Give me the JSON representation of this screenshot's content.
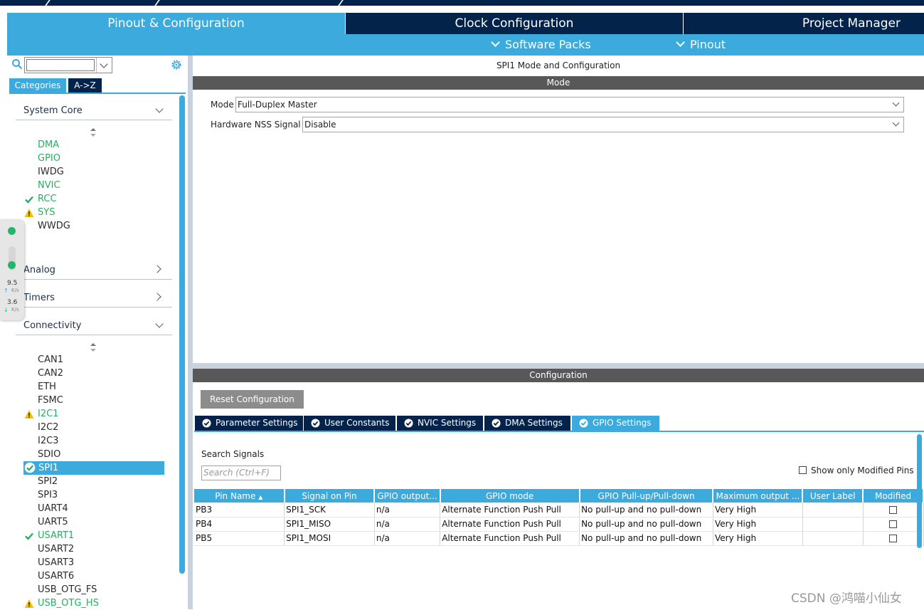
{
  "main_tabs": {
    "pinout": "Pinout & Configuration",
    "clock": "Clock Configuration",
    "project": "Project Manager"
  },
  "sub_menu": {
    "software_packs": "Software Packs",
    "pinout": "Pinout"
  },
  "left": {
    "search_value": "",
    "view_tabs": {
      "categories": "Categories",
      "az": "A->Z"
    },
    "system_core": {
      "header": "System Core",
      "items": [
        {
          "label": "DMA",
          "status": "configured"
        },
        {
          "label": "GPIO",
          "status": "configured"
        },
        {
          "label": "IWDG",
          "status": "none"
        },
        {
          "label": "NVIC",
          "status": "configured"
        },
        {
          "label": "RCC",
          "status": "ok"
        },
        {
          "label": "SYS",
          "status": "warning"
        },
        {
          "label": "WWDG",
          "status": "none"
        }
      ]
    },
    "analog": {
      "header": "Analog"
    },
    "timers": {
      "header": "Timers"
    },
    "connectivity": {
      "header": "Connectivity",
      "items": [
        {
          "label": "CAN1",
          "status": "none"
        },
        {
          "label": "CAN2",
          "status": "none"
        },
        {
          "label": "ETH",
          "status": "none"
        },
        {
          "label": "FSMC",
          "status": "none"
        },
        {
          "label": "I2C1",
          "status": "warning"
        },
        {
          "label": "I2C2",
          "status": "none"
        },
        {
          "label": "I2C3",
          "status": "none"
        },
        {
          "label": "SDIO",
          "status": "none"
        },
        {
          "label": "SPI1",
          "status": "selected"
        },
        {
          "label": "SPI2",
          "status": "none"
        },
        {
          "label": "SPI3",
          "status": "none"
        },
        {
          "label": "UART4",
          "status": "none"
        },
        {
          "label": "UART5",
          "status": "none"
        },
        {
          "label": "USART1",
          "status": "ok"
        },
        {
          "label": "USART2",
          "status": "none"
        },
        {
          "label": "USART3",
          "status": "none"
        },
        {
          "label": "USART6",
          "status": "none"
        },
        {
          "label": "USB_OTG_FS",
          "status": "none"
        },
        {
          "label": "USB_OTG_HS",
          "status": "warning"
        }
      ]
    }
  },
  "float_widget": {
    "upload_value": "9.5",
    "upload_unit": "K/s",
    "download_value": "3.6",
    "download_unit": "K/s"
  },
  "mode_panel": {
    "title": "SPI1 Mode and Configuration",
    "mode_header": "Mode",
    "mode_label": "Mode",
    "mode_value": "Full-Duplex Master",
    "nss_label": "Hardware NSS Signal",
    "nss_value": "Disable"
  },
  "config_panel": {
    "header": "Configuration",
    "reset_button": "Reset Configuration",
    "tabs": [
      "Parameter Settings",
      "User Constants",
      "NVIC Settings",
      "DMA Settings",
      "GPIO Settings"
    ],
    "active_tab": "GPIO Settings",
    "search_label": "Search Signals",
    "search_placeholder": "Search (Ctrl+F)",
    "show_modified_label": "Show only Modified Pins",
    "table": {
      "columns": [
        "Pin Name",
        "Signal on Pin",
        "GPIO output...",
        "GPIO mode",
        "GPIO Pull-up/Pull-down",
        "Maximum output ...",
        "User Label",
        "Modified"
      ],
      "rows": [
        [
          "PB3",
          "SPI1_SCK",
          "n/a",
          "Alternate Function Push Pull",
          "No pull-up and no pull-down",
          "Very High",
          "",
          ""
        ],
        [
          "PB4",
          "SPI1_MISO",
          "n/a",
          "Alternate Function Push Pull",
          "No pull-up and no pull-down",
          "Very High",
          "",
          ""
        ],
        [
          "PB5",
          "SPI1_MOSI",
          "n/a",
          "Alternate Function Push Pull",
          "No pull-up and no pull-down",
          "Very High",
          "",
          ""
        ]
      ]
    }
  },
  "watermark": "CSDN @鸿喵小仙女",
  "colors": {
    "accent": "#3caadc",
    "navy": "#03234b",
    "configured_green": "#27ae60",
    "warning_yellow": "#f2c200"
  }
}
